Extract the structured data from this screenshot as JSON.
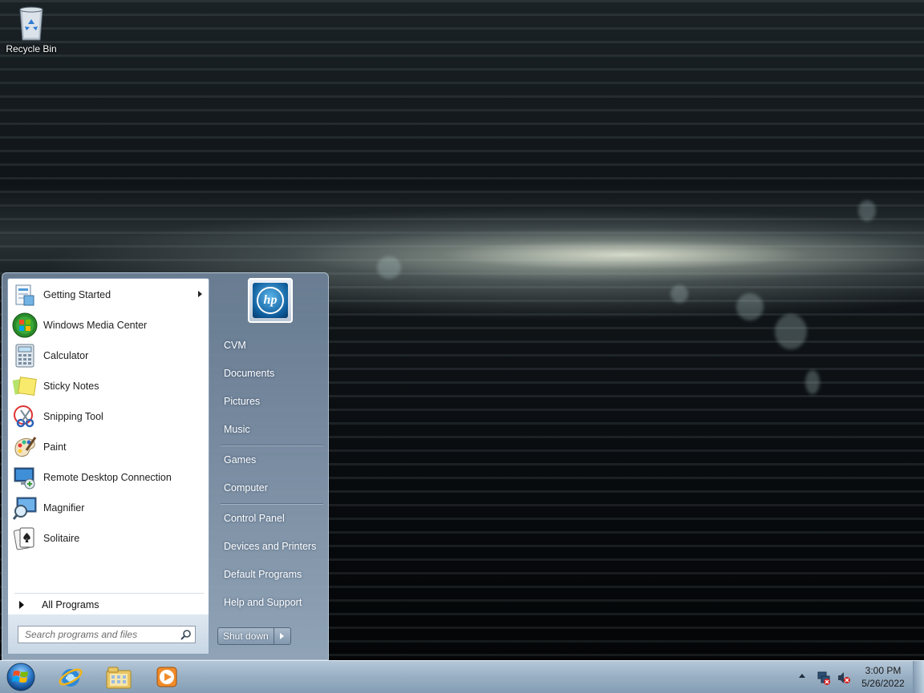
{
  "desktop": {
    "recycle_bin_label": "Recycle Bin"
  },
  "start_menu": {
    "programs": [
      {
        "label": "Getting Started",
        "icon": "getting-started-icon",
        "has_submenu": true
      },
      {
        "label": "Windows Media Center",
        "icon": "windows-media-center-icon",
        "has_submenu": false
      },
      {
        "label": "Calculator",
        "icon": "calculator-icon",
        "has_submenu": false
      },
      {
        "label": "Sticky Notes",
        "icon": "sticky-notes-icon",
        "has_submenu": false
      },
      {
        "label": "Snipping Tool",
        "icon": "snipping-tool-icon",
        "has_submenu": false
      },
      {
        "label": "Paint",
        "icon": "paint-icon",
        "has_submenu": false
      },
      {
        "label": "Remote Desktop Connection",
        "icon": "remote-desktop-icon",
        "has_submenu": false
      },
      {
        "label": "Magnifier",
        "icon": "magnifier-icon",
        "has_submenu": false
      },
      {
        "label": "Solitaire",
        "icon": "solitaire-icon",
        "has_submenu": false
      }
    ],
    "all_programs_label": "All Programs",
    "search_placeholder": "Search programs and files",
    "user_picture_icon": "hp-logo-icon",
    "user_picture_text": "hp",
    "places": {
      "cvm": "CVM",
      "documents": "Documents",
      "pictures": "Pictures",
      "music": "Music",
      "games": "Games",
      "computer": "Computer",
      "control_panel": "Control Panel",
      "devices_and_printers": "Devices and Printers",
      "default_programs": "Default Programs",
      "help_and_support": "Help and Support"
    },
    "shutdown_label": "Shut down"
  },
  "taskbar": {
    "pinned": [
      "internet-explorer-icon",
      "windows-explorer-icon",
      "windows-media-player-icon"
    ],
    "tray_icons": [
      "network-icon",
      "volume-muted-icon"
    ],
    "clock_time": "3:00 PM",
    "clock_date": "5/26/2022"
  }
}
